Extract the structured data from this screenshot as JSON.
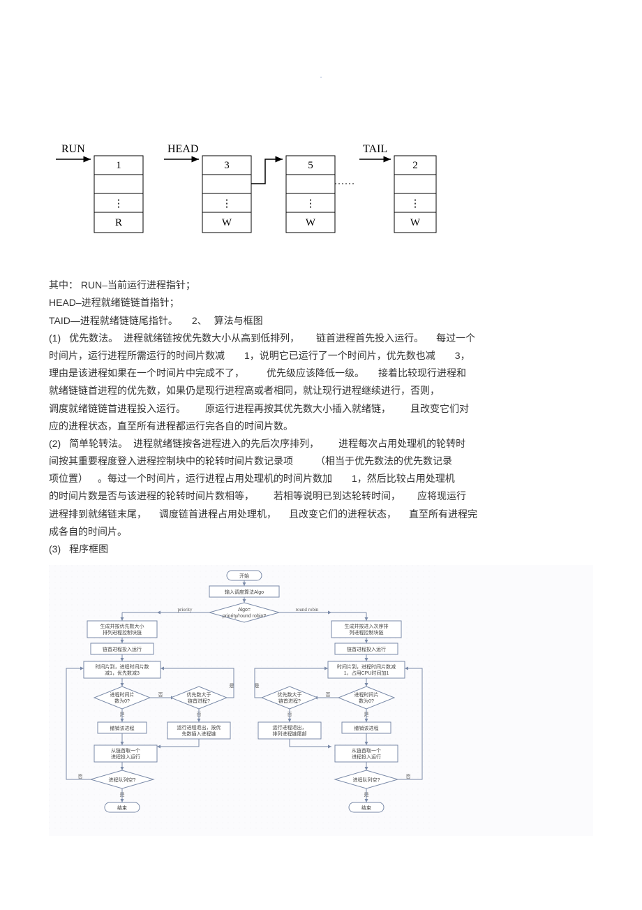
{
  "dot": ".",
  "diagram1": {
    "labels": {
      "run": "RUN",
      "head": "HEAD",
      "tail": "TAIL"
    },
    "boxes": [
      {
        "top": "1",
        "mid": "⋮",
        "bot": "R"
      },
      {
        "top": "3",
        "mid": "⋮",
        "bot": "W"
      },
      {
        "top": "5",
        "mid": "⋮",
        "bot": "W"
      },
      {
        "top": "2",
        "mid": "⋮",
        "bot": "W"
      }
    ]
  },
  "text": {
    "l1a": "其中：",
    "l1b": "RUN",
    "l1c": "–当前运行进程指针；",
    "l2a": "HEAD",
    "l2b": "–进程就绪链链首指针；",
    "l3a": "TAID",
    "l3b": "—进程就绪链链尾指针。",
    "l3c": "2、",
    "l3d": "算法与框图",
    "p1a": "(1)",
    "p1b": "优先数法。",
    "p1c": "进程就绪链按优先数大小从高到低排列，",
    "p1d": "链首进程首先投入运行。",
    "p1e": "每过一个",
    "p2a": "时间片，运行进程所需运行的时间片数减",
    "p2b": "1",
    "p2c": "，说明它已运行了一个时间片，优先数也减",
    "p2d": "3",
    "p2e": "，",
    "p3a": "理由是该进程如果在一个时间片中完成不了，",
    "p3b": "优先级应该降低一级。",
    "p3c": "接着比较现行进程和",
    "p4": "就绪链链首进程的优先数，如果仍是现行进程高或者相同，就让现行进程继续进行，否则，",
    "p5a": "调度就绪链链首进程投入运行。",
    "p5b": "原运行进程再按其优先数大小插入就绪链，",
    "p5c": "且改变它们对",
    "p6": "应的进程状态，直至所有进程都运行完各自的时间片数。",
    "q1a": "(2)",
    "q1b": "简单轮转法。",
    "q1c": "进程就绪链按各进程进入的先后次序排列，",
    "q1d": "进程每次占用处理机的轮转时",
    "q2a": "间按其重要程度登入进程控制块中的轮转时间片数记录项",
    "q2b": "（相当于优先数法的优先数记录",
    "q3a": "项位置）",
    "q3b": "。每过一个时间片，运行进程占用处理机的时间片数加",
    "q3c": "1",
    "q3d": "，然后比较占用处理机",
    "q4a": "的时间片数是否与该进程的轮转时间片数相等，",
    "q4b": "若相等说明已到达轮转时间，",
    "q4c": "应将现运行",
    "q5a": "进程排到就绪链末尾，",
    "q5b": "调度链首进程占用处理机，",
    "q5c": "且改变它们的进程状态，",
    "q5d": "直至所有进程完",
    "q6": "成各自的时间片。",
    "r1a": "(3)",
    "r1b": "程序框图"
  },
  "chart_data": {
    "type": "flowchart",
    "top": {
      "start": "开始",
      "input": "输入调度算法Algo",
      "decision": "Algo= priority/round robin?",
      "left_label": "priority",
      "right_label": "round robin"
    },
    "left": {
      "b1": "生成并按优先数大小排列进程控制块链",
      "b2": "链首进程投入运行",
      "b3": "时间片到，进程时间片数减1，优先数减3",
      "d1": "进程时间片数为0?",
      "d2": "优先数大于链首进程?",
      "b4": "撤销该进程",
      "b5": "运行进程退出，按优先数插入进程链",
      "b6": "从链首取一个进程投入运行",
      "d3": "进程队列空?",
      "end": "结束"
    },
    "right": {
      "b1": "生成并按进入次序排列进程控制块链",
      "b2": "链首进程投入运行",
      "b3": "时间片到，进程时间片数减1，占用CPU时间加1",
      "d1": "进程时间片数为0?",
      "d2": "优先数大于链首进程?",
      "b4": "撤销该进程",
      "b5": "运行进程退出，排列进程链尾部",
      "b6": "从链首取一个进程投入运行",
      "d3": "进程队列空?",
      "end": "结束"
    },
    "labels": {
      "yes": "是",
      "no": "否"
    }
  }
}
